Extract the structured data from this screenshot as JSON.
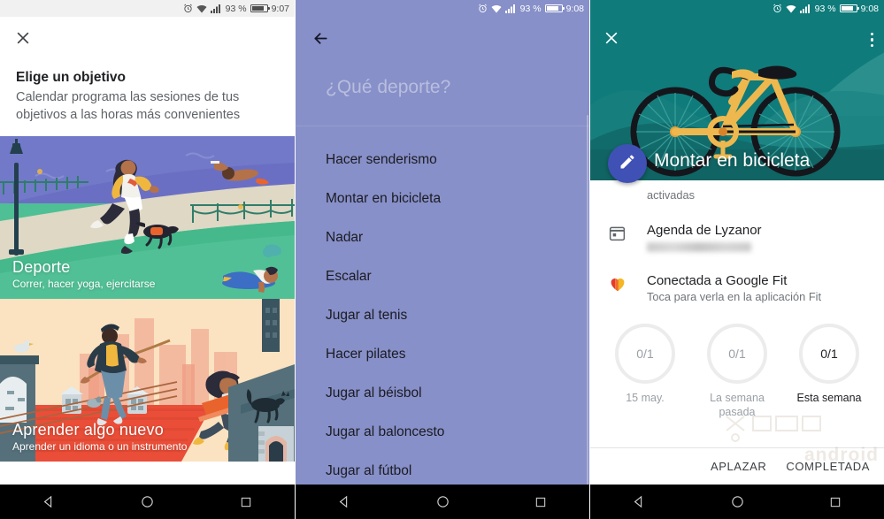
{
  "statusbar": {
    "battery": "93 %",
    "time_left": "9:07",
    "time_mid": "9:08",
    "time_right": "9:08"
  },
  "panel1": {
    "close_icon": "close-icon",
    "title": "Elige un objetivo",
    "subtitle": "Calendar programa las sesiones de tus objetivos a las horas más convenientes",
    "cards": [
      {
        "title": "Deporte",
        "subtitle": "Correr, hacer yoga, ejercitarse"
      },
      {
        "title": "Aprender algo nuevo",
        "subtitle": "Aprender un idioma o un instrumento"
      }
    ]
  },
  "panel2": {
    "back_icon": "back-arrow-icon",
    "question": "¿Qué deporte?",
    "bg_color": "#8790c8",
    "items": [
      "Hacer senderismo",
      "Montar en bicicleta",
      "Nadar",
      "Escalar",
      "Jugar al tenis",
      "Hacer pilates",
      "Jugar al béisbol",
      "Jugar al baloncesto",
      "Jugar al fútbol"
    ]
  },
  "panel3": {
    "close_icon": "close-icon",
    "overflow_icon": "overflow-menu-icon",
    "hero_title": "Montar en bicicleta",
    "hero_color": "#0f7b7b",
    "fab": {
      "icon": "edit-pencil-icon",
      "color": "#3f51b5"
    },
    "rows": [
      {
        "icon": "",
        "primary": "",
        "secondary": "activadas"
      },
      {
        "icon": "calendar-icon",
        "primary": "Agenda de Lyzanor",
        "secondary": ""
      },
      {
        "icon": "google-fit-heart-icon",
        "primary": "Conectada a Google Fit",
        "secondary": "Toca para verla en la aplicación Fit"
      }
    ],
    "progress": [
      {
        "value": "0/1",
        "caption": "15 may.",
        "active": false
      },
      {
        "value": "0/1",
        "caption": "La semana pasada",
        "active": false
      },
      {
        "value": "0/1",
        "caption": "Esta semana",
        "active": true
      }
    ],
    "actions": {
      "snooze": "APLAZAR",
      "complete": "COMPLETADA"
    },
    "watermark": "android"
  },
  "navbar": {
    "back": "back-triangle-icon",
    "home": "home-circle-icon",
    "recents": "recents-square-icon"
  }
}
